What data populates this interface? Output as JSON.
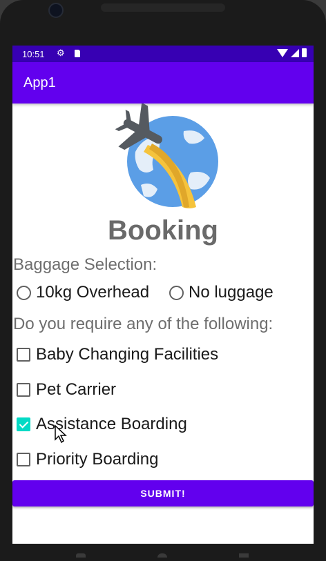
{
  "status_bar": {
    "time": "10:51",
    "icons": [
      "settings-icon",
      "sd-card-icon",
      "wifi-icon",
      "signal-icon",
      "battery-icon"
    ]
  },
  "app_bar": {
    "title": "App1"
  },
  "logo": {
    "description_icon": "airplane-globe-logo"
  },
  "heading": "Booking",
  "baggage": {
    "label": "Baggage Selection:",
    "options": [
      {
        "label": "10kg Overhead",
        "selected": false
      },
      {
        "label": "No luggage",
        "selected": false
      }
    ]
  },
  "requirements": {
    "label": "Do you require any of the following:",
    "items": [
      {
        "label": "Baby Changing Facilities",
        "checked": false
      },
      {
        "label": "Pet Carrier",
        "checked": false
      },
      {
        "label": "Assistance Boarding",
        "checked": true
      },
      {
        "label": "Priority Boarding",
        "checked": false
      }
    ]
  },
  "submit_label": "SUBMIT!",
  "colors": {
    "primary": "#6200ee",
    "primary_dark": "#3700b3",
    "accent": "#03dac5",
    "heading_gray": "#6a6a6a"
  }
}
